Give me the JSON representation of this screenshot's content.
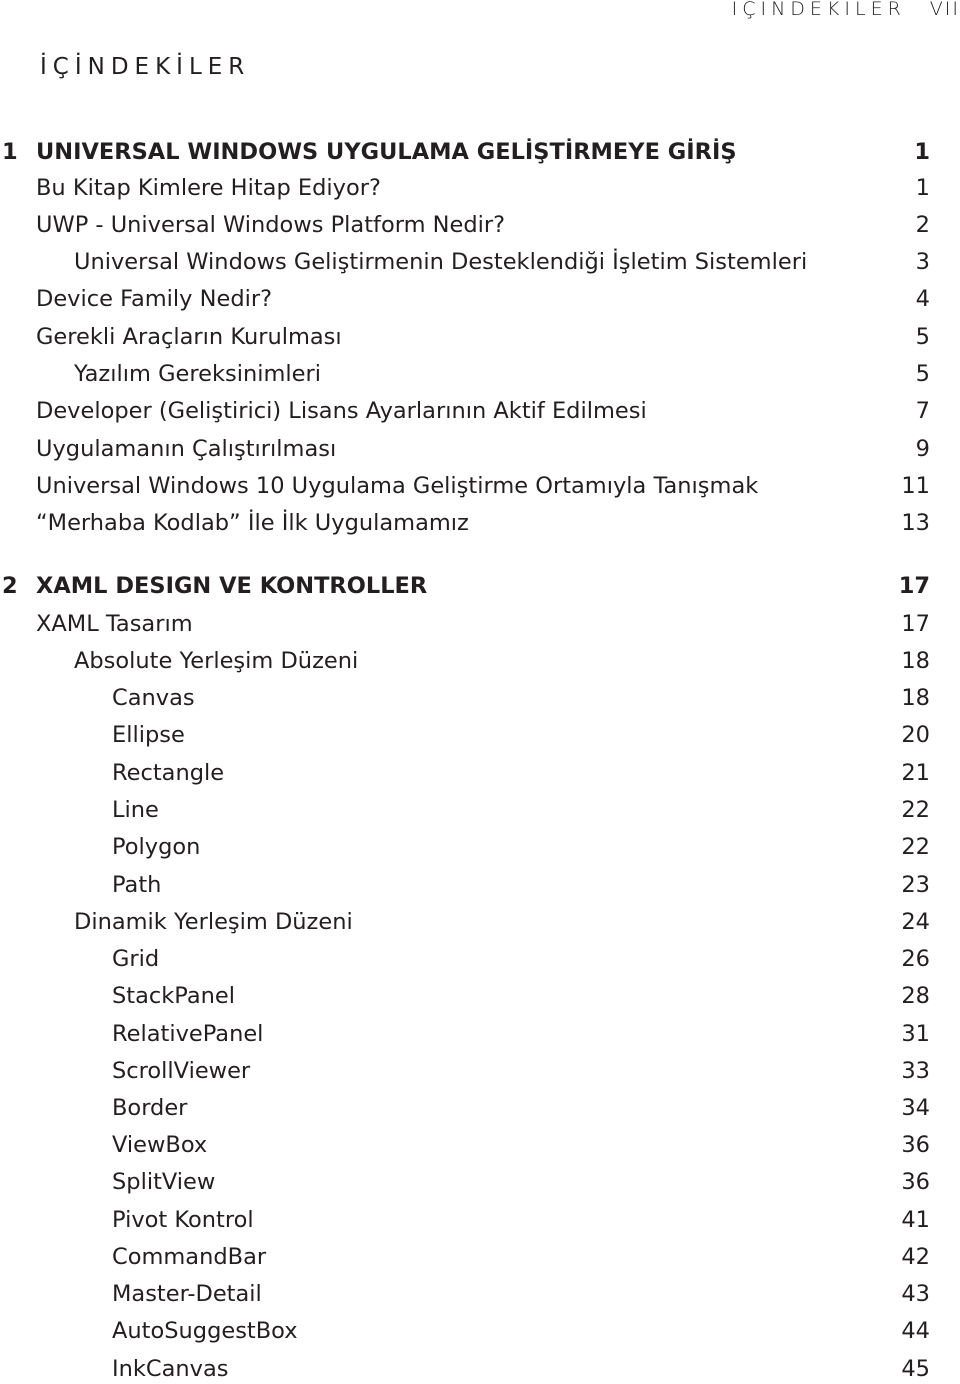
{
  "running_head": {
    "title": "İÇİNDEKİLER",
    "page": "VII"
  },
  "toc_title": "İÇİNDEKİLER",
  "entries": [
    {
      "type": "chapter",
      "num": "1",
      "label": "UNIVERSAL WINDOWS UYGULAMA GELİŞTİRMEYE GİRİŞ",
      "page": "1",
      "level": 1
    },
    {
      "type": "entry",
      "label": "Bu Kitap Kimlere Hitap Ediyor?",
      "page": "1",
      "level": 1
    },
    {
      "type": "entry",
      "label": "UWP - Universal Windows Platform Nedir?",
      "page": "2",
      "level": 1
    },
    {
      "type": "entry",
      "label": "Universal Windows Geliştirmenin Desteklendiği İşletim Sistemleri",
      "page": "3",
      "level": 2
    },
    {
      "type": "entry",
      "label": "Device Family Nedir?",
      "page": "4",
      "level": 1
    },
    {
      "type": "entry",
      "label": "Gerekli Araçların Kurulması",
      "page": "5",
      "level": 1
    },
    {
      "type": "entry",
      "label": "Yazılım Gereksinimleri",
      "page": "5",
      "level": 2
    },
    {
      "type": "entry",
      "label": "Developer (Geliştirici) Lisans Ayarlarının Aktif Edilmesi",
      "page": "7",
      "level": 1
    },
    {
      "type": "entry",
      "label": "Uygulamanın Çalıştırılması",
      "page": "9",
      "level": 1
    },
    {
      "type": "entry",
      "label": "Universal Windows 10 Uygulama Geliştirme Ortamıyla Tanışmak",
      "page": "11",
      "level": 1
    },
    {
      "type": "entry",
      "label": "“Merhaba Kodlab” İle İlk Uygulamamız",
      "page": "13",
      "level": 1
    },
    {
      "type": "chapter",
      "num": "2",
      "label": "XAML DESIGN VE KONTROLLER",
      "page": "17",
      "level": 1
    },
    {
      "type": "entry",
      "label": "XAML Tasarım",
      "page": "17",
      "level": 1
    },
    {
      "type": "entry",
      "label": "Absolute Yerleşim Düzeni",
      "page": "18",
      "level": 2
    },
    {
      "type": "entry",
      "label": "Canvas",
      "page": "18",
      "level": 3
    },
    {
      "type": "entry",
      "label": "Ellipse",
      "page": "20",
      "level": 3
    },
    {
      "type": "entry",
      "label": "Rectangle",
      "page": "21",
      "level": 3
    },
    {
      "type": "entry",
      "label": "Line",
      "page": "22",
      "level": 3
    },
    {
      "type": "entry",
      "label": "Polygon",
      "page": "22",
      "level": 3
    },
    {
      "type": "entry",
      "label": "Path",
      "page": "23",
      "level": 3
    },
    {
      "type": "entry",
      "label": "Dinamik Yerleşim Düzeni",
      "page": "24",
      "level": 2
    },
    {
      "type": "entry",
      "label": "Grid",
      "page": "26",
      "level": 3
    },
    {
      "type": "entry",
      "label": "StackPanel",
      "page": "28",
      "level": 3
    },
    {
      "type": "entry",
      "label": "RelativePanel",
      "page": "31",
      "level": 3
    },
    {
      "type": "entry",
      "label": "ScrollViewer",
      "page": "33",
      "level": 3
    },
    {
      "type": "entry",
      "label": "Border",
      "page": "34",
      "level": 3
    },
    {
      "type": "entry",
      "label": "ViewBox",
      "page": "36",
      "level": 3
    },
    {
      "type": "entry",
      "label": "SplitView",
      "page": "36",
      "level": 3
    },
    {
      "type": "entry",
      "label": "Pivot Kontrol",
      "page": "41",
      "level": 3
    },
    {
      "type": "entry",
      "label": "CommandBar",
      "page": "42",
      "level": 3
    },
    {
      "type": "entry",
      "label": "Master-Detail",
      "page": "43",
      "level": 3
    },
    {
      "type": "entry",
      "label": "AutoSuggestBox",
      "page": "44",
      "level": 3
    },
    {
      "type": "entry",
      "label": "InkCanvas",
      "page": "45",
      "level": 3
    }
  ]
}
